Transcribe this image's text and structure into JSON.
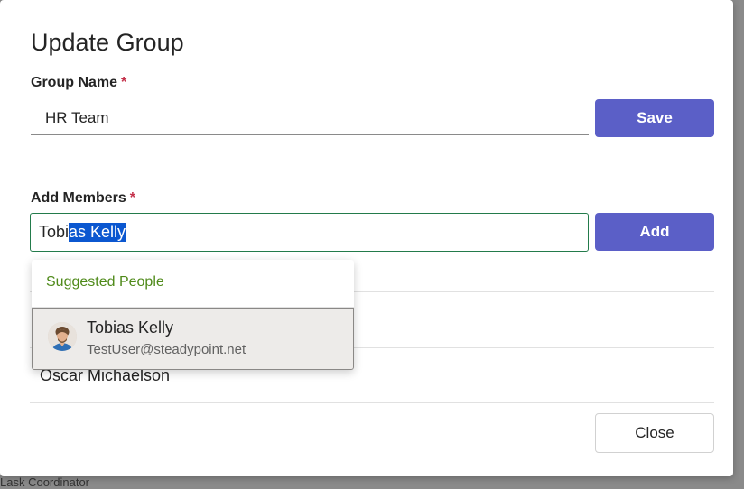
{
  "background": {
    "partial_text": "Lask    Coordinator"
  },
  "dialog": {
    "title": "Update Group",
    "group_name": {
      "label": "Group Name",
      "required_mark": "*",
      "value": "HR Team",
      "save_label": "Save"
    },
    "add_members": {
      "label": "Add Members",
      "required_mark": "*",
      "typed_text": "Tobi",
      "selected_text": "as Kelly",
      "add_label": "Add"
    },
    "suggestions": {
      "header": "Suggested People",
      "items": [
        {
          "name": "Tobias Kelly",
          "email": "TestUser@steadypoint.net",
          "avatar_icon": "person-avatar-icon"
        }
      ]
    },
    "members": [
      {
        "name": "Oscar Michaelson"
      }
    ],
    "close_label": "Close"
  },
  "colors": {
    "primary": "#5b5fc7",
    "required": "#c4314b",
    "focus_border": "#237b4b",
    "suggestion_header": "#4f8a1a",
    "selection": "#0b57d0"
  }
}
